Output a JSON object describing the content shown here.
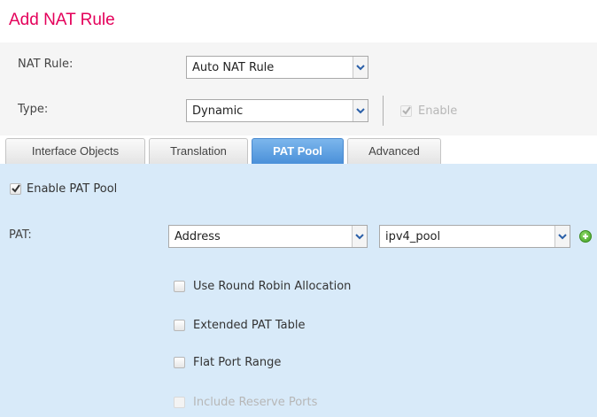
{
  "dialog": {
    "title": "Add NAT Rule"
  },
  "form": {
    "nat_rule_label": "NAT Rule:",
    "nat_rule_value": "Auto NAT Rule",
    "type_label": "Type:",
    "type_value": "Dynamic",
    "enable_label": "Enable",
    "enable_checked": true,
    "enable_disabled": true
  },
  "tabs": [
    {
      "label": "Interface Objects",
      "active": false
    },
    {
      "label": "Translation",
      "active": false
    },
    {
      "label": "PAT Pool",
      "active": true
    },
    {
      "label": "Advanced",
      "active": false
    }
  ],
  "pat_pool": {
    "enable_pat_pool_label": "Enable PAT Pool",
    "enable_pat_pool_checked": true,
    "pat_label": "PAT:",
    "pat_type_value": "Address",
    "pat_object_value": "ipv4_pool",
    "options": [
      {
        "label": "Use Round Robin Allocation",
        "checked": false,
        "disabled": false
      },
      {
        "label": "Extended PAT Table",
        "checked": false,
        "disabled": false
      },
      {
        "label": "Flat Port Range",
        "checked": false,
        "disabled": false
      },
      {
        "label": "Include Reserve Ports",
        "checked": false,
        "disabled": true
      }
    ]
  },
  "icons": {
    "dropdown": "chevron-down-icon",
    "add": "add-circle-icon",
    "check": "checkmark-icon"
  },
  "colors": {
    "title": "#e4005a",
    "active_tab": "#4a90d9",
    "panel_background": "#d8eaf9",
    "add_icon": "#3f9d22"
  }
}
